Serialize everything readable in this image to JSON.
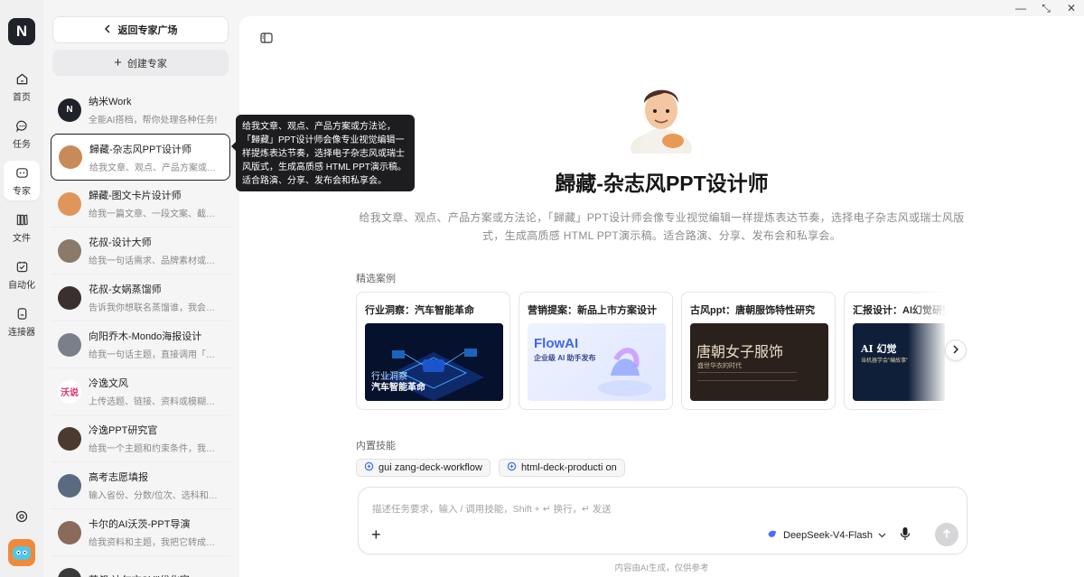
{
  "window": {
    "minimize": "—",
    "restore": "⤡",
    "close": "✕"
  },
  "rail": {
    "logo": "N",
    "items": [
      {
        "label": "首页",
        "icon": "home-icon"
      },
      {
        "label": "任务",
        "icon": "chat-icon"
      },
      {
        "label": "专家",
        "icon": "expert-icon",
        "active": true
      },
      {
        "label": "文件",
        "icon": "files-icon"
      },
      {
        "label": "自动化",
        "icon": "automation-icon"
      },
      {
        "label": "连接器",
        "icon": "connector-icon"
      }
    ]
  },
  "panel": {
    "back_label": "返回专家广场",
    "create_label": "创建专家",
    "experts": [
      {
        "name": "纳米Work",
        "desc": "全能AI搭档，帮你处理各种任务!",
        "color": "#1f2229",
        "initial": "N"
      },
      {
        "name": "歸藏-杂志风PPT设计师",
        "desc": "给我文章、观点、产品方案或方法论，「歸藏」PPT设计师会像专业视觉编辑一样提炼表达节奏",
        "color": "#c98a5a",
        "initial": "",
        "selected": true
      },
      {
        "name": "歸藏-图文卡片设计师",
        "desc": "给我一篇文章、一段文案、截图或素材",
        "color": "#e0965a",
        "initial": ""
      },
      {
        "name": "花叔-设计大师",
        "desc": "给我一句话需求、品牌素材或产品截图",
        "color": "#8a7a6a",
        "initial": ""
      },
      {
        "name": "花叔-女娲蒸馏师",
        "desc": "告诉我你想联名蒸馏谁，我会自动搜集资料",
        "color": "#3a3030",
        "initial": ""
      },
      {
        "name": "向阳乔木-Mondo海报设计",
        "desc": "给我一句话主题，直接调用「向日葵」风格",
        "color": "#7a7f8a",
        "initial": ""
      },
      {
        "name": "冷逸文风",
        "desc": "上传选题、链接、资料或模糊想法",
        "color": "#ffffff",
        "initial": "沃说"
      },
      {
        "name": "冷逸PPT研究官",
        "desc": "给我一个主题和约束条件，我会用深度研究",
        "color": "#4a3a30",
        "initial": ""
      },
      {
        "name": "高考志愿填报",
        "desc": "输入省份、分数/位次、选科和目标城市",
        "color": "#5a6a80",
        "initial": ""
      },
      {
        "name": "卡尔的AI沃茨-PPT导演",
        "desc": "给我资料和主题，我把它转成有说服力的演示",
        "color": "#8a6a5a",
        "initial": ""
      },
      {
        "name": "花叔-达尔文Skill优化官",
        "desc": "",
        "color": "#3a3a3a",
        "initial": ""
      }
    ]
  },
  "tooltip": "给我文章、观点、产品方案或方法论，「歸藏」PPT设计师会像专业视觉编辑一样提炼表达节奏，选择电子杂志风或瑞士风版式，生成高质感 HTML PPT演示稿。适合路演、分享、发布会和私享会。",
  "main": {
    "title": "歸藏-杂志风PPT设计师",
    "description": "给我文章、观点、产品方案或方法论，「歸藏」PPT设计师会像专业视觉编辑一样提炼表达节奏，选择电子杂志风或瑞士风版式，生成高质感 HTML PPT演示稿。适合路演、分享、发布会和私享会。",
    "cases_label": "精选案例",
    "cases": [
      {
        "title": "行业洞察：汽车智能革命",
        "thumb_title": "行业洞察",
        "thumb_sub": "汽车智能革命"
      },
      {
        "title": "营销提案：新品上市方案设计",
        "thumb_title": "FlowAI",
        "thumb_sub": "企业级 AI 助手发布"
      },
      {
        "title": "古风ppt：唐朝服饰特性研究",
        "thumb_title": "唐朝女子服饰",
        "thumb_sub": "盛世华衣的时代"
      },
      {
        "title": "汇报设计：AI幻觉研究",
        "thumb_title": "AI 幻觉",
        "thumb_sub": "当机器学会\"编故事\""
      }
    ],
    "skills_label": "内置技能",
    "skills": [
      "gui zang-deck-workflow",
      "html-deck-producti on"
    ],
    "composer": {
      "placeholder": "描述任务要求，输入 / 调用技能，Shift + ↵ 换行，↵ 发送",
      "model": "DeepSeek-V4-Flash"
    },
    "footer": "内容由AI生成，仅供参考"
  }
}
